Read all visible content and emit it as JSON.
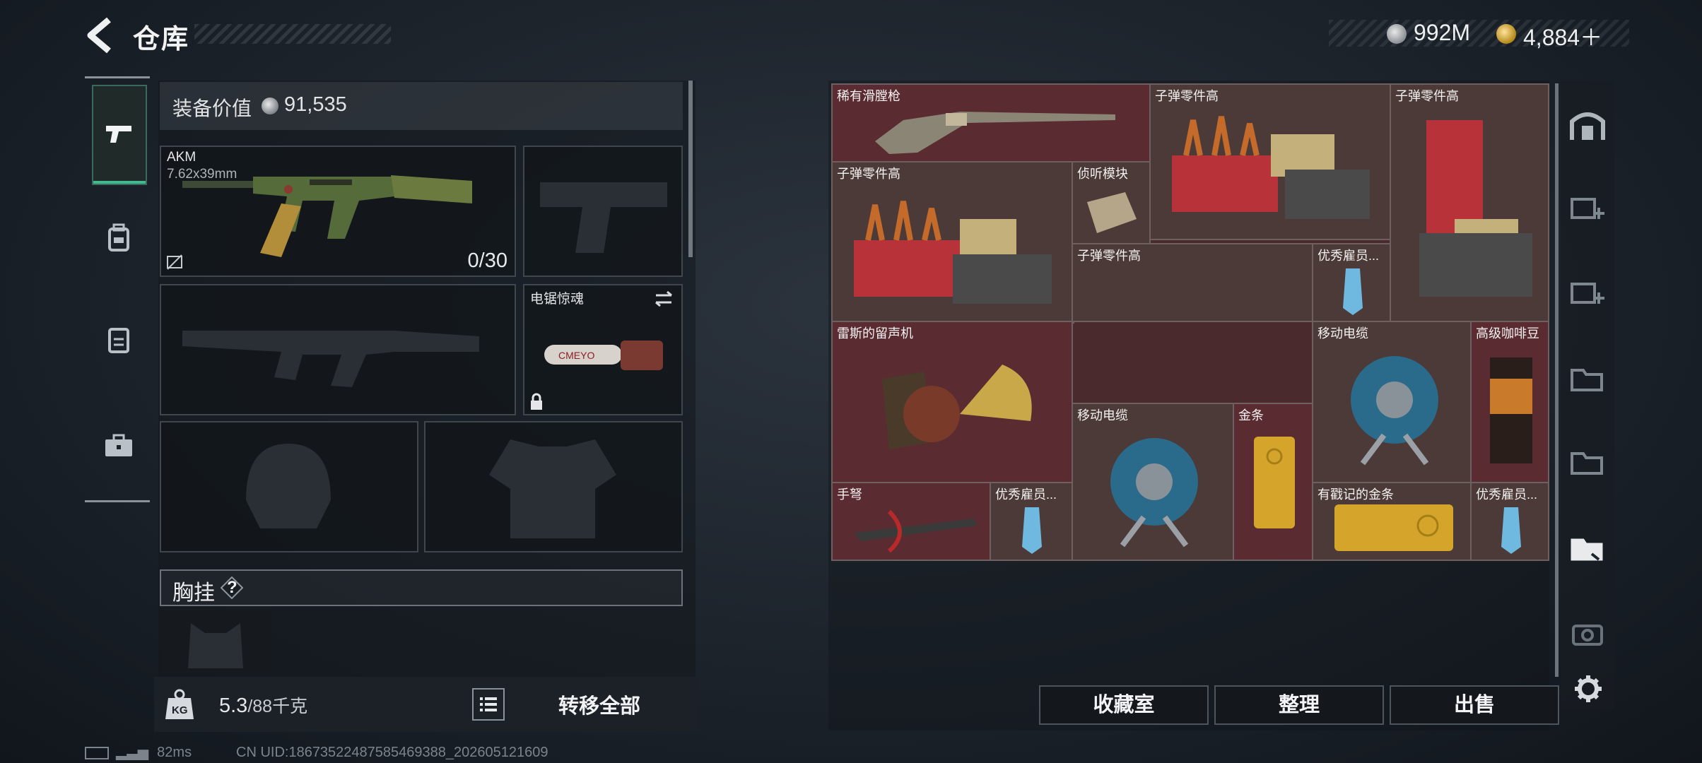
{
  "header": {
    "title": "仓库"
  },
  "currency": {
    "silver": "992M",
    "gold": "4,884＋"
  },
  "equipment": {
    "value_label": "装备价值",
    "value": "91,535",
    "primary_weapon": {
      "name": "AKM",
      "caliber": "7.62x39mm",
      "ammo": "0/30"
    },
    "melee": {
      "name": "电锯惊魂"
    },
    "chest_rig_label": "胸挂",
    "chest_rig_help": "?",
    "weight": "5.3",
    "weight_max": "/88千克",
    "transfer_all": "转移全部"
  },
  "stash": {
    "items": [
      {
        "label": "稀有滑膛枪"
      },
      {
        "label": "子弹零件高"
      },
      {
        "label": "子弹零件高"
      },
      {
        "label": "子弹零件高"
      },
      {
        "label": "侦听模块"
      },
      {
        "label": "子弹零件高"
      },
      {
        "label": "优秀雇员..."
      },
      {
        "label": "雷斯的留声机"
      },
      {
        "label": "移动电缆"
      },
      {
        "label": "高级咖啡豆"
      },
      {
        "label": "移动电缆"
      },
      {
        "label": "金条"
      },
      {
        "label": "手弩"
      },
      {
        "label": "优秀雇员..."
      },
      {
        "label": "有戳记的金条"
      },
      {
        "label": "优秀雇员..."
      }
    ],
    "actions": {
      "collection": "收藏室",
      "sort": "整理",
      "sell": "出售"
    }
  },
  "status": {
    "ping": "82ms",
    "uid": "CN UID:18673522487585469388_202605121609"
  },
  "colors": {
    "accent_green": "#43b98d",
    "stash_red": "#5a2c31",
    "gold": "#d4a52a"
  }
}
